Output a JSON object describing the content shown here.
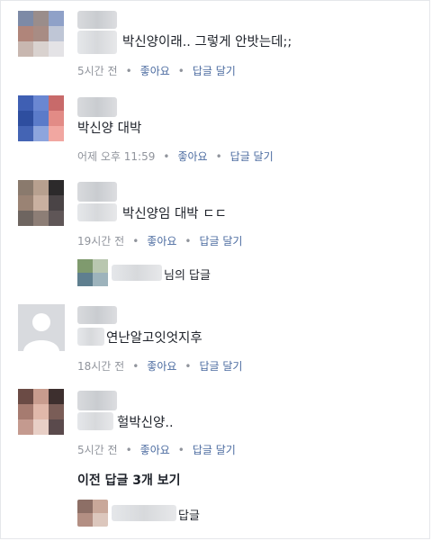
{
  "comments": [
    {
      "text": "박신양이래.. 그렇게 안밧는데;;",
      "time": "5시간 전",
      "like": "좋아요",
      "reply": "답글 달기"
    },
    {
      "text": "박신양 대박",
      "time": "어제 오후 11:59",
      "like": "좋아요",
      "reply": "답글 달기"
    },
    {
      "text": "박신양임 대박 ㄷㄷ",
      "time": "19시간 전",
      "like": "좋아요",
      "reply": "답글 달기",
      "reply_summary": "님의 답글"
    },
    {
      "text": "연난알고잇엇지후",
      "time": "18시간 전",
      "like": "좋아요",
      "reply": "답글 달기"
    },
    {
      "text": "헐박신양..",
      "time": "5시간 전",
      "like": "좋아요",
      "reply": "답글 달기"
    }
  ],
  "more_replies": "이전 답글 3개 보기",
  "last_reply": "답글",
  "separator": "•",
  "icons": [
    "avatar",
    "profile-silhouette-icon"
  ]
}
